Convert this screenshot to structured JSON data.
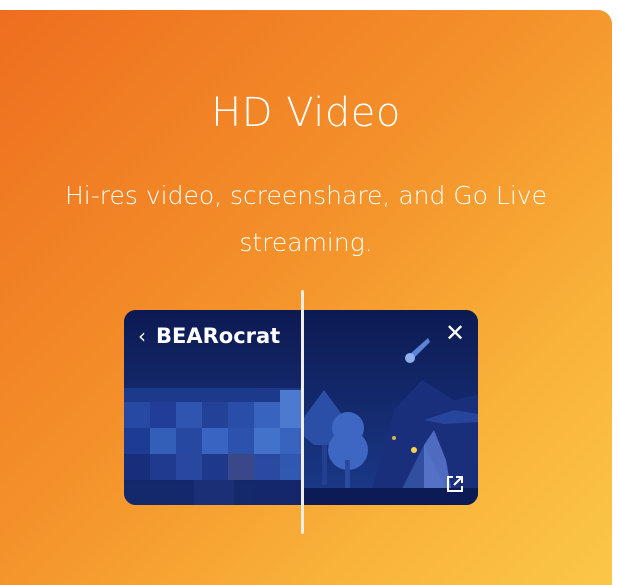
{
  "feature": {
    "title": "HD Video",
    "subtitle": "Hi-res video, screenshare, and Go Live streaming."
  },
  "preview": {
    "stream_name": "BEARocrat",
    "icons": {
      "back": "chevron-left-icon",
      "close": "close-icon",
      "popout": "popout-icon"
    }
  },
  "colors": {
    "gradient_start": "#ee6e1f",
    "gradient_end": "#fbc748",
    "video_bg": "#0f1f5c",
    "divider": "#f2ede3"
  }
}
